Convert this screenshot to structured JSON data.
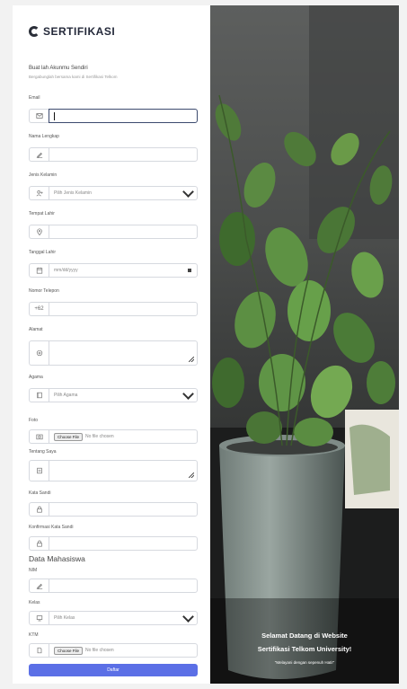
{
  "brand": {
    "name": "SERTIFIKASI"
  },
  "intro": {
    "heading": "Buat lah Akunmu Sendiri",
    "subheading": "Bergabunglah bersama kami di Sertifikasi Telkom"
  },
  "fields": {
    "email": {
      "label": "Email"
    },
    "nama": {
      "label": "Nama Lengkap"
    },
    "gender": {
      "label": "Jenis Kelamin",
      "value": "Pilih Jenis Kelamin"
    },
    "tempat": {
      "label": "Tempat Lahir"
    },
    "tanggal": {
      "label": "Tanggal Lahir",
      "placeholder": "mm/dd/yyyy"
    },
    "telepon": {
      "label": "Nomor Telepon",
      "prefix": "+62"
    },
    "alamat": {
      "label": "Alamat"
    },
    "agama": {
      "label": "Agama",
      "value": "Pilih Agama"
    },
    "foto": {
      "label": "Foto",
      "button": "Choose File",
      "status": "No file chosen"
    },
    "tentang": {
      "label": "Tentang Saya"
    },
    "sandi": {
      "label": "Kata Sandi"
    },
    "konfirmasi": {
      "label": "Konfirmasi Kata Sandi"
    }
  },
  "mahasiswa": {
    "title": "Data Mahasiswa",
    "nim": {
      "label": "NIM"
    },
    "kelas": {
      "label": "Kelas",
      "value": "Pilih Kelas"
    },
    "ktm": {
      "label": "KTM",
      "button": "Choose File",
      "status": "No file chosen"
    }
  },
  "submit": {
    "label": "Daftar"
  },
  "hero": {
    "line1": "Selamat Datang di Website",
    "line2": "Sertifikasi Telkom University!",
    "tagline": "\"Melayani dengan sepenuh Hati!\""
  },
  "icons": [
    "envelope-icon",
    "pencil-icon",
    "user-plus-icon",
    "location-icon",
    "calendar-icon",
    "home-icon",
    "book-icon",
    "camera-icon",
    "document-icon",
    "lock-icon",
    "monitor-icon",
    "file-icon"
  ]
}
